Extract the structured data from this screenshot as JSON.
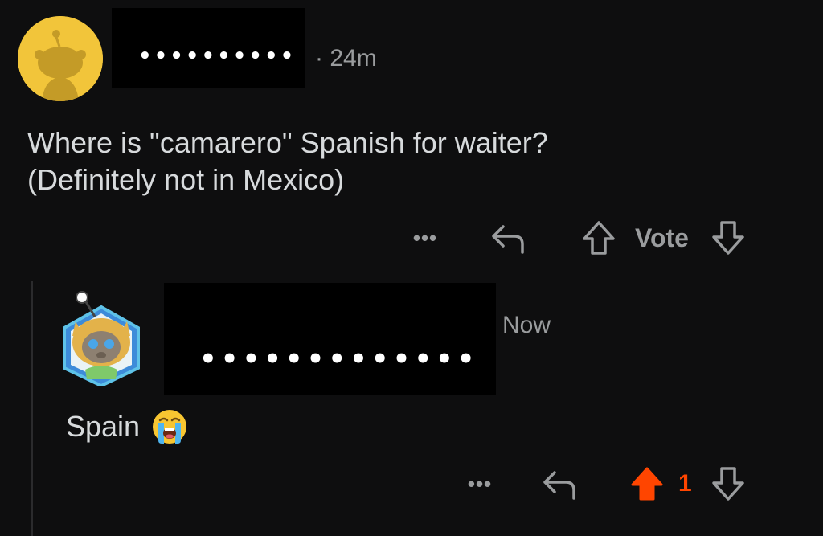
{
  "comment": {
    "author_redacted": "••••••••••",
    "meta": "· 24m",
    "body_line1": "Where is \"camarero\" Spanish for waiter?",
    "body_line2": "(Definitely not in Mexico)",
    "actions": {
      "more": "•••",
      "vote_label": "Vote"
    }
  },
  "reply": {
    "author_redacted": "•••••••••••••",
    "meta": "Now",
    "body": "Spain",
    "emoji": "loudly-crying-face",
    "actions": {
      "more": "•••",
      "vote_count": "1",
      "upvoted": true
    }
  },
  "colors": {
    "background": "#0e0e0f",
    "text": "#d7dadc",
    "muted": "#9a9c9e",
    "upvote": "#ff4500",
    "avatar_yellow": "#f2c53a"
  }
}
